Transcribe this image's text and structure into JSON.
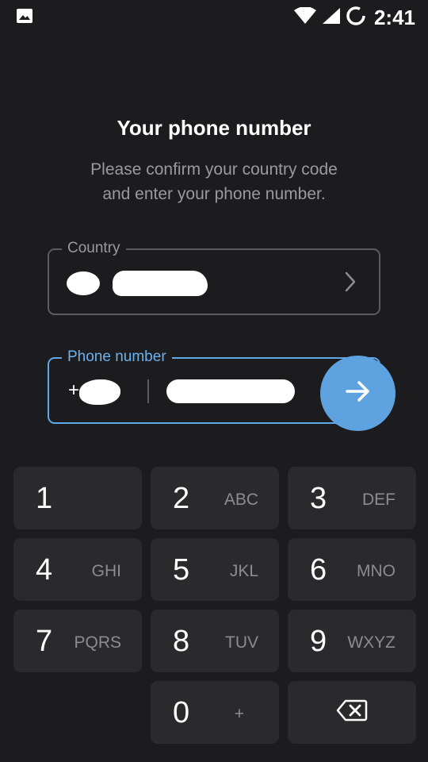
{
  "status_bar": {
    "time": "2:41",
    "icons": [
      "image-icon",
      "wifi-icon",
      "cellular-icon",
      "sync-icon"
    ]
  },
  "header": {
    "title": "Your phone number",
    "subtitle_line1": "Please confirm your country code",
    "subtitle_line2": "and enter your phone number."
  },
  "country_field": {
    "label": "Country",
    "icon": "chevron-right-icon"
  },
  "phone_field": {
    "label": "Phone number",
    "prefix": "+"
  },
  "next_button": {
    "icon": "arrow-right-icon"
  },
  "keypad": {
    "keys": [
      {
        "digit": "1",
        "letters": ""
      },
      {
        "digit": "2",
        "letters": "ABC"
      },
      {
        "digit": "3",
        "letters": "DEF"
      },
      {
        "digit": "4",
        "letters": "GHI"
      },
      {
        "digit": "5",
        "letters": "JKL"
      },
      {
        "digit": "6",
        "letters": "MNO"
      },
      {
        "digit": "7",
        "letters": "PQRS"
      },
      {
        "digit": "8",
        "letters": "TUV"
      },
      {
        "digit": "9",
        "letters": "WXYZ"
      },
      {
        "digit": "0",
        "letters": "+"
      }
    ],
    "backspace_icon": "backspace-icon"
  },
  "colors": {
    "background": "#1c1c1e",
    "accent": "#5ea2e0",
    "key_background": "#2a2a2d",
    "muted_text": "#9a9a9e"
  }
}
